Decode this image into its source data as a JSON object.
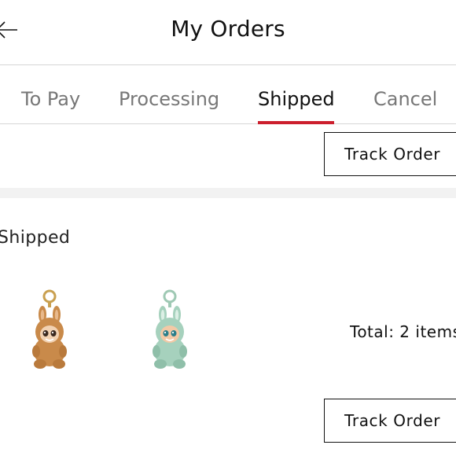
{
  "header": {
    "title": "My Orders",
    "back_icon": "arrow-left-icon"
  },
  "tabs": [
    {
      "label": "To Pay",
      "active": false
    },
    {
      "label": "Processing",
      "active": false
    },
    {
      "label": "Shipped",
      "active": true
    },
    {
      "label": "Cancel",
      "active": false
    }
  ],
  "accent_color": "#cc1f2d",
  "orders": [
    {
      "track_label": "Track Order"
    },
    {
      "status": "Shipped",
      "items": [
        {
          "icon": "plush-keychain-brown"
        },
        {
          "icon": "plush-keychain-green"
        }
      ],
      "total_text": "Total: 2 items",
      "track_label": "Track Order"
    }
  ]
}
